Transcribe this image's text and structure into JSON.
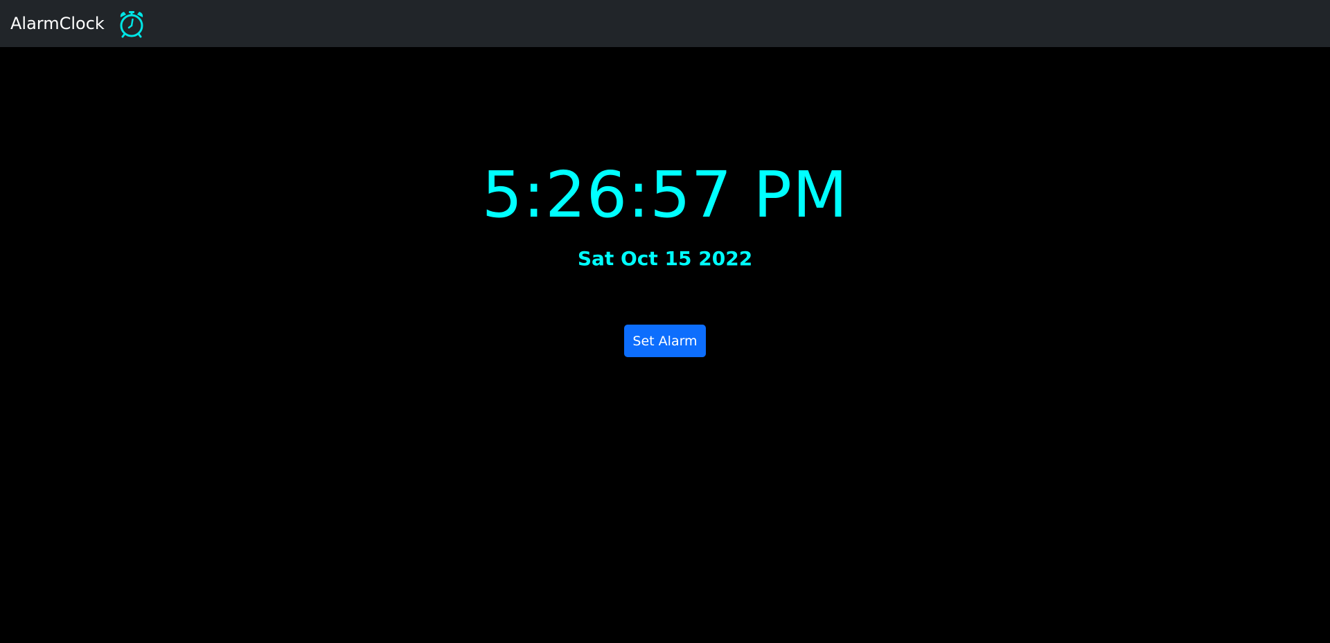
{
  "navbar": {
    "brand": "AlarmClock",
    "icon": "alarm-clock-icon",
    "background": "#212529"
  },
  "clock": {
    "time": "5:26:57 PM",
    "date": "Sat Oct 15 2022",
    "color": "#00ffff"
  },
  "actions": {
    "set_alarm_label": "Set Alarm",
    "button_color": "#0d6efd"
  },
  "page": {
    "background": "#000000"
  }
}
